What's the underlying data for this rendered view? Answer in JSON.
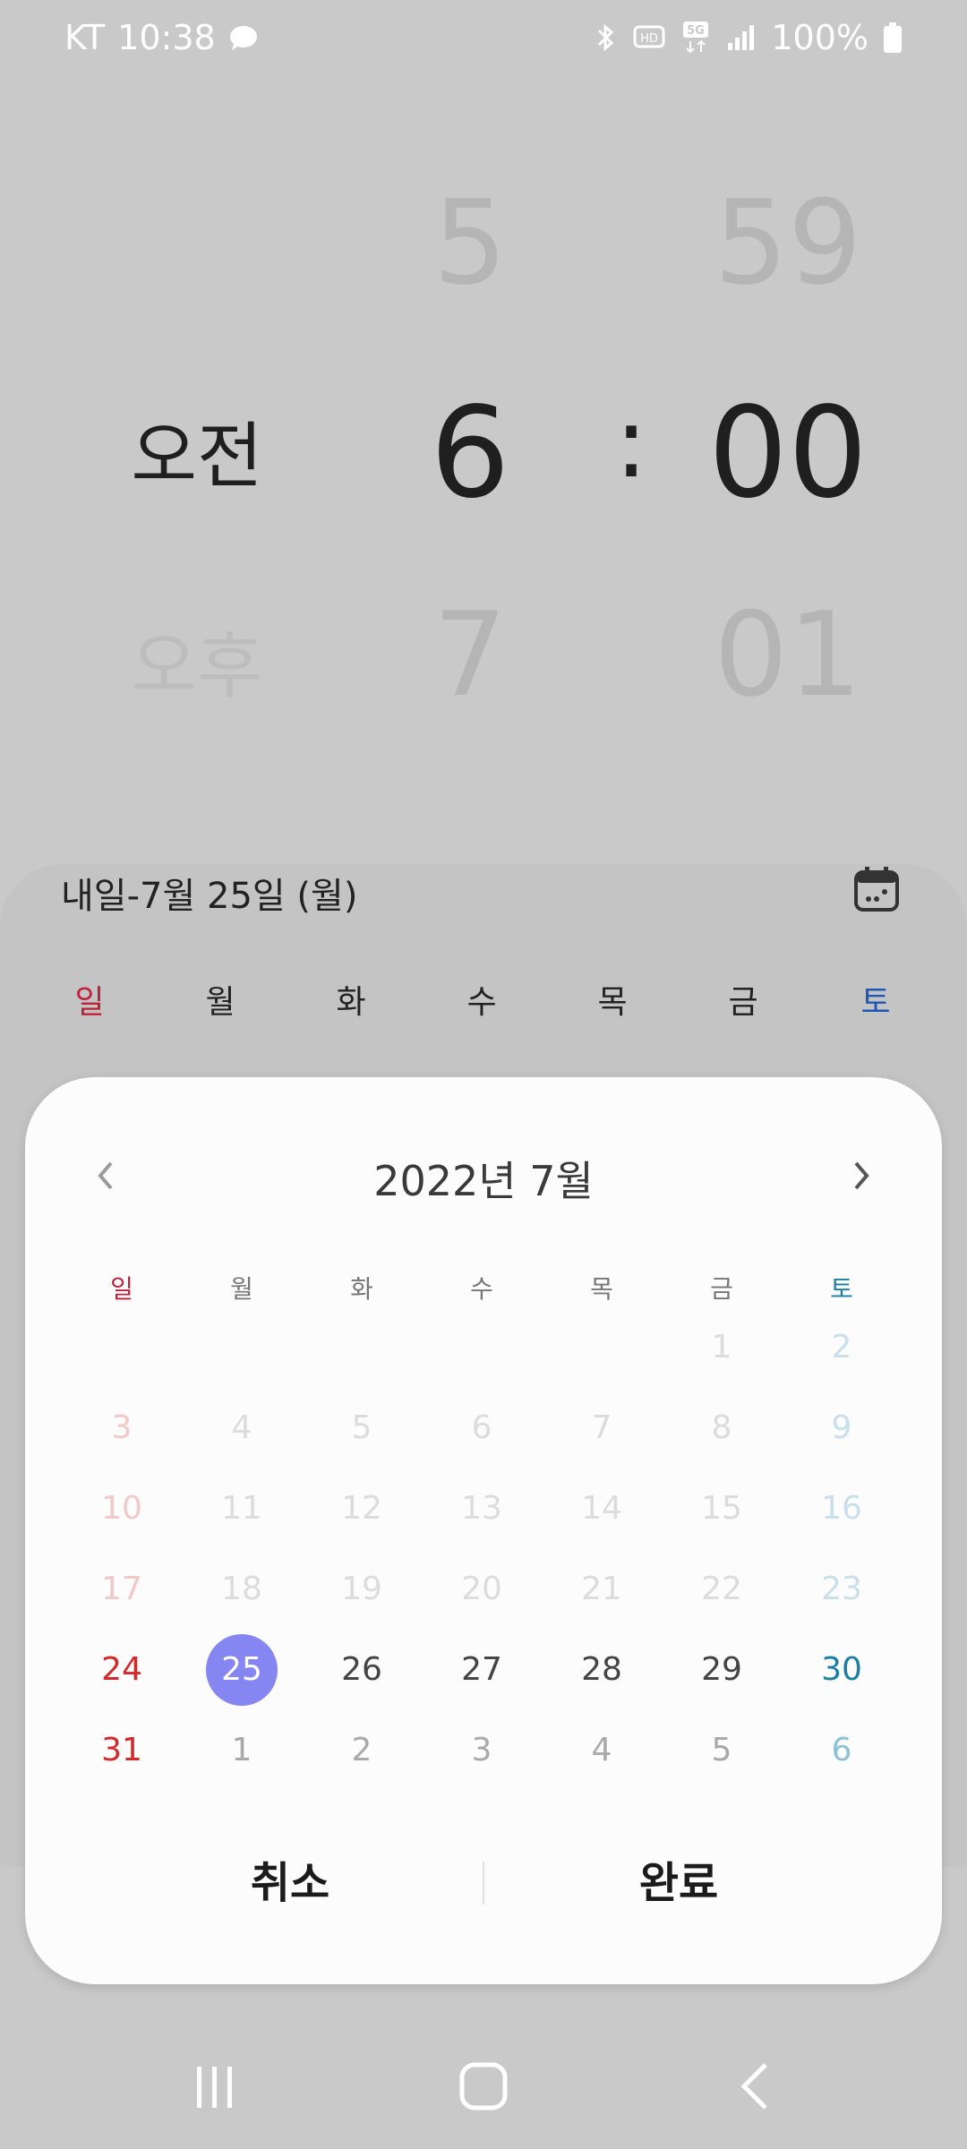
{
  "status": {
    "carrier": "KT",
    "time": "10:38",
    "battery": "100%",
    "icons": [
      "chat-bubble-icon",
      "bluetooth-icon",
      "hd-voice-icon",
      "5g-icon",
      "signal-icon",
      "battery-icon"
    ]
  },
  "time_picker": {
    "ampm_selected": "오전",
    "ampm_next": "오후",
    "hour_prev": "5",
    "hour_selected": "6",
    "hour_next": "7",
    "separator": ":",
    "minute_prev": "59",
    "minute_selected": "00",
    "minute_next": "01"
  },
  "sheet": {
    "date_text": "내일-7월 25일 (월)",
    "weekdays": [
      "일",
      "월",
      "화",
      "수",
      "목",
      "금",
      "토"
    ]
  },
  "calendar": {
    "title": "2022년 7월",
    "dow": [
      "일",
      "월",
      "화",
      "수",
      "목",
      "금",
      "토"
    ],
    "weeks": [
      [
        "",
        "",
        "",
        "",
        "",
        "1",
        "2"
      ],
      [
        "3",
        "4",
        "5",
        "6",
        "7",
        "8",
        "9"
      ],
      [
        "10",
        "11",
        "12",
        "13",
        "14",
        "15",
        "16"
      ],
      [
        "17",
        "18",
        "19",
        "20",
        "21",
        "22",
        "23"
      ],
      [
        "24",
        "25",
        "26",
        "27",
        "28",
        "29",
        "30"
      ],
      [
        "31",
        "1",
        "2",
        "3",
        "4",
        "5",
        "6"
      ]
    ],
    "selected": "25",
    "cancel_label": "취소",
    "done_label": "완료"
  },
  "colors": {
    "sunday": "#d12a2a",
    "saturday": "#1a7fa4",
    "selected": "#8686f2"
  }
}
